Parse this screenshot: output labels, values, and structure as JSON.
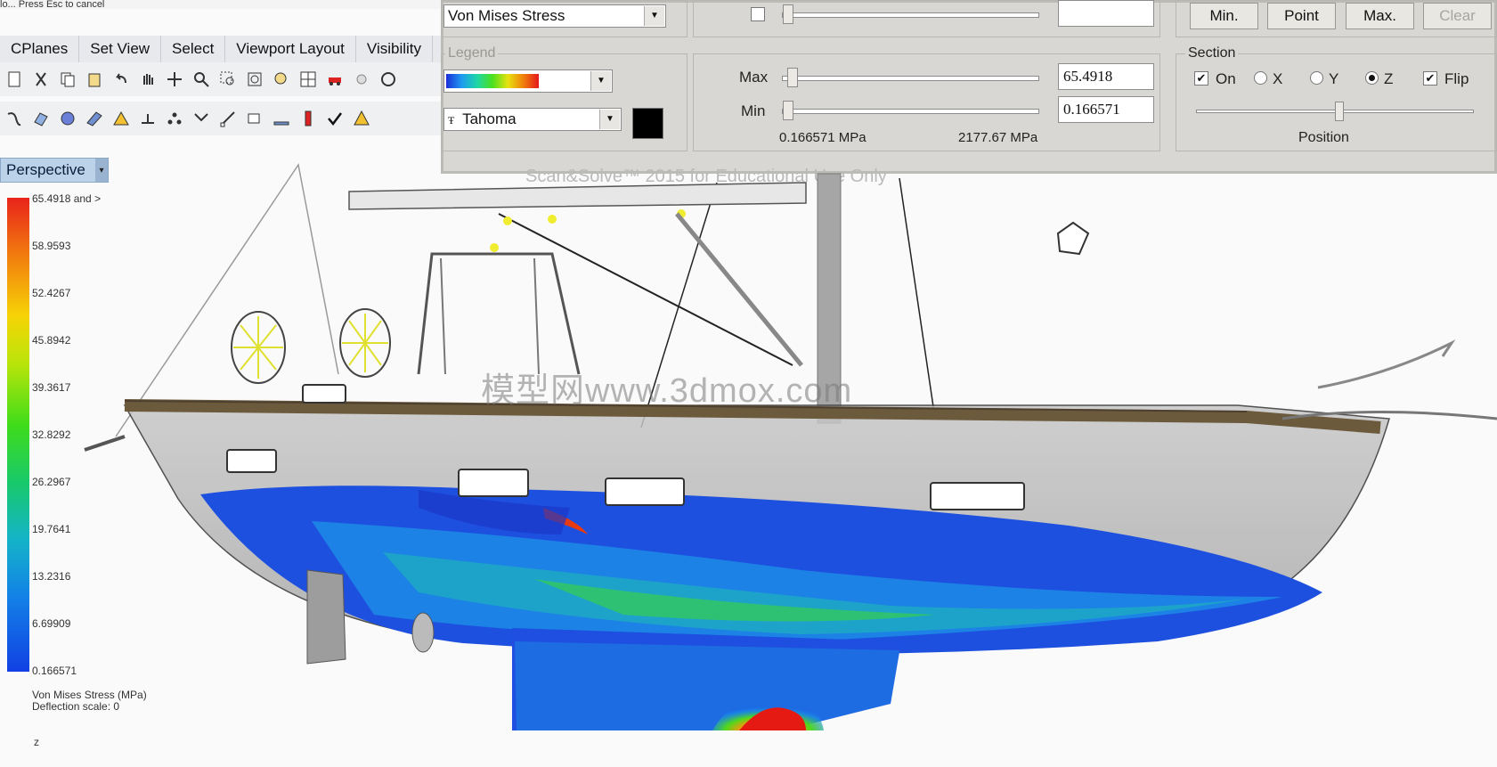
{
  "command_line": "lo... Press Esc to cancel",
  "tabs": [
    "CPlanes",
    "Set View",
    "Select",
    "Viewport Layout",
    "Visibility"
  ],
  "viewport": {
    "name": "Perspective",
    "watermark": "Scan&Solve™ 2015 for Educational Use Only",
    "site_watermark": "模型网www.3dmox.com",
    "legend_title": "Von Mises Stress (MPa)",
    "deflection_label": "Deflection scale: 0",
    "axis_label": "z",
    "scale_values": [
      "65.4918 and >",
      "58.9593",
      "52.4267",
      "45.8942",
      "39.3617",
      "32.8292",
      "26.2967",
      "19.7641",
      "13.2316",
      "6.69909",
      "0.166571"
    ]
  },
  "dialog": {
    "result_type": "Von Mises Stress",
    "legend_group": "Legend",
    "font": "Tahoma",
    "max_label": "Max",
    "min_label": "Min",
    "max_value": "65.4918",
    "min_value": "0.166571",
    "min_mpa": "0.166571 MPa",
    "max_mpa": "2177.67 MPa",
    "buttons": {
      "min": "Min.",
      "point": "Point",
      "max": "Max.",
      "clear": "Clear"
    },
    "section": {
      "title": "Section",
      "on": "On",
      "x": "X",
      "y": "Y",
      "z": "Z",
      "flip": "Flip",
      "position": "Position"
    }
  }
}
